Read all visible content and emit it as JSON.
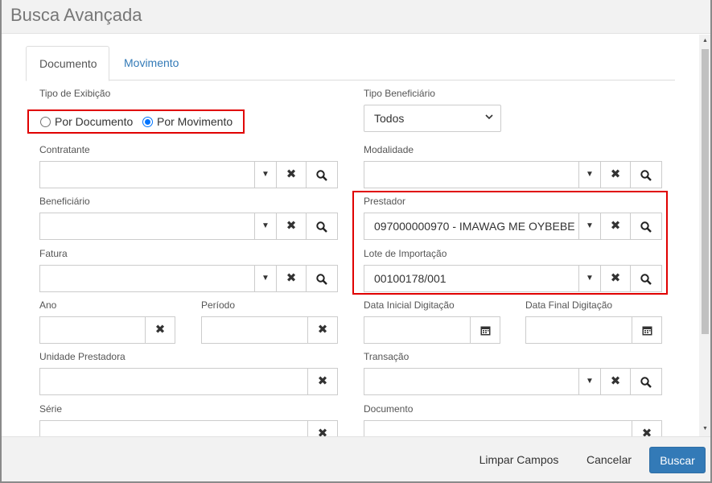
{
  "modal": {
    "title": "Busca Avançada"
  },
  "tabs": [
    {
      "label": "Documento"
    },
    {
      "label": "Movimento"
    }
  ],
  "form": {
    "tipo_exibicao": {
      "label": "Tipo de Exibição",
      "options": [
        {
          "label": "Por Documento",
          "checked": false
        },
        {
          "label": "Por Movimento",
          "checked": true
        }
      ]
    },
    "tipo_beneficiario": {
      "label": "Tipo Beneficiário",
      "value": "Todos"
    },
    "contratante": {
      "label": "Contratante",
      "value": ""
    },
    "modalidade": {
      "label": "Modalidade",
      "value": ""
    },
    "beneficiario": {
      "label": "Beneficiário",
      "value": ""
    },
    "prestador": {
      "label": "Prestador",
      "value": "097000000970 - IMAWAG ME OYBEBE"
    },
    "fatura": {
      "label": "Fatura",
      "value": ""
    },
    "lote_importacao": {
      "label": "Lote de Importação",
      "value": "00100178/001"
    },
    "ano": {
      "label": "Ano",
      "value": ""
    },
    "periodo": {
      "label": "Período",
      "value": ""
    },
    "data_inicial_digitacao": {
      "label": "Data Inicial Digitação",
      "value": ""
    },
    "data_final_digitacao": {
      "label": "Data Final Digitação",
      "value": ""
    },
    "unidade_prestadora": {
      "label": "Unidade Prestadora",
      "value": ""
    },
    "transacao": {
      "label": "Transação",
      "value": ""
    },
    "serie": {
      "label": "Série",
      "value": ""
    },
    "documento": {
      "label": "Documento",
      "value": ""
    }
  },
  "footer": {
    "clear_label": "Limpar Campos",
    "cancel_label": "Cancelar",
    "search_label": "Buscar"
  },
  "colors": {
    "primary": "#337ab7",
    "highlight": "#e00000",
    "radio_accent": "#0075ff"
  },
  "icons": {
    "caret": "caret-down-icon",
    "clear": "close-icon",
    "search": "search-icon",
    "calendar": "calendar-icon"
  }
}
